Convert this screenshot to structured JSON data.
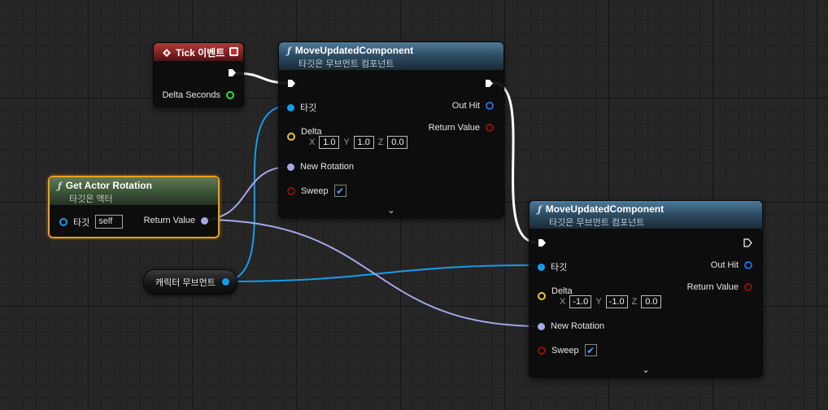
{
  "colors": {
    "exec": "#ffffff",
    "object_pin": "#1a9be8",
    "vector_pin": "#f2c030",
    "rotator_pin": "#a4a8e8",
    "struct_pin": "#1a6ee0",
    "bool_pin": "#8e1010",
    "float_pin": "#35e03a",
    "selection": "#e8a21a"
  },
  "tick_node": {
    "title": "Tick 이벤트",
    "icon": "event-diamond-icon",
    "delta_seconds_label": "Delta Seconds"
  },
  "move_node_1": {
    "title": "MoveUpdatedComponent",
    "subtitle": "타깃은 무브먼트 컴포넌트",
    "target_label": "타깃",
    "delta_label": "Delta",
    "delta_x_label": "X",
    "delta_x": "1.0",
    "delta_y_label": "Y",
    "delta_y": "1.0",
    "delta_z_label": "Z",
    "delta_z": "0.0",
    "new_rotation_label": "New Rotation",
    "sweep_label": "Sweep",
    "sweep_checked": true,
    "out_hit_label": "Out Hit",
    "return_value_label": "Return Value"
  },
  "move_node_2": {
    "title": "MoveUpdatedComponent",
    "subtitle": "타깃은 무브먼트 컴포넌트",
    "target_label": "타깃",
    "delta_label": "Delta",
    "delta_x_label": "X",
    "delta_x": "-1.0",
    "delta_y_label": "Y",
    "delta_y": "-1.0",
    "delta_z_label": "Z",
    "delta_z": "0.0",
    "new_rotation_label": "New Rotation",
    "sweep_label": "Sweep",
    "sweep_checked": true,
    "out_hit_label": "Out Hit",
    "return_value_label": "Return Value"
  },
  "get_actor_rotation": {
    "title": "Get Actor Rotation",
    "subtitle": "타깃은 액터",
    "target_label": "타깃",
    "target_default": "self",
    "return_value_label": "Return Value"
  },
  "character_movement_var": {
    "label": "캐릭터 무브먼트"
  }
}
